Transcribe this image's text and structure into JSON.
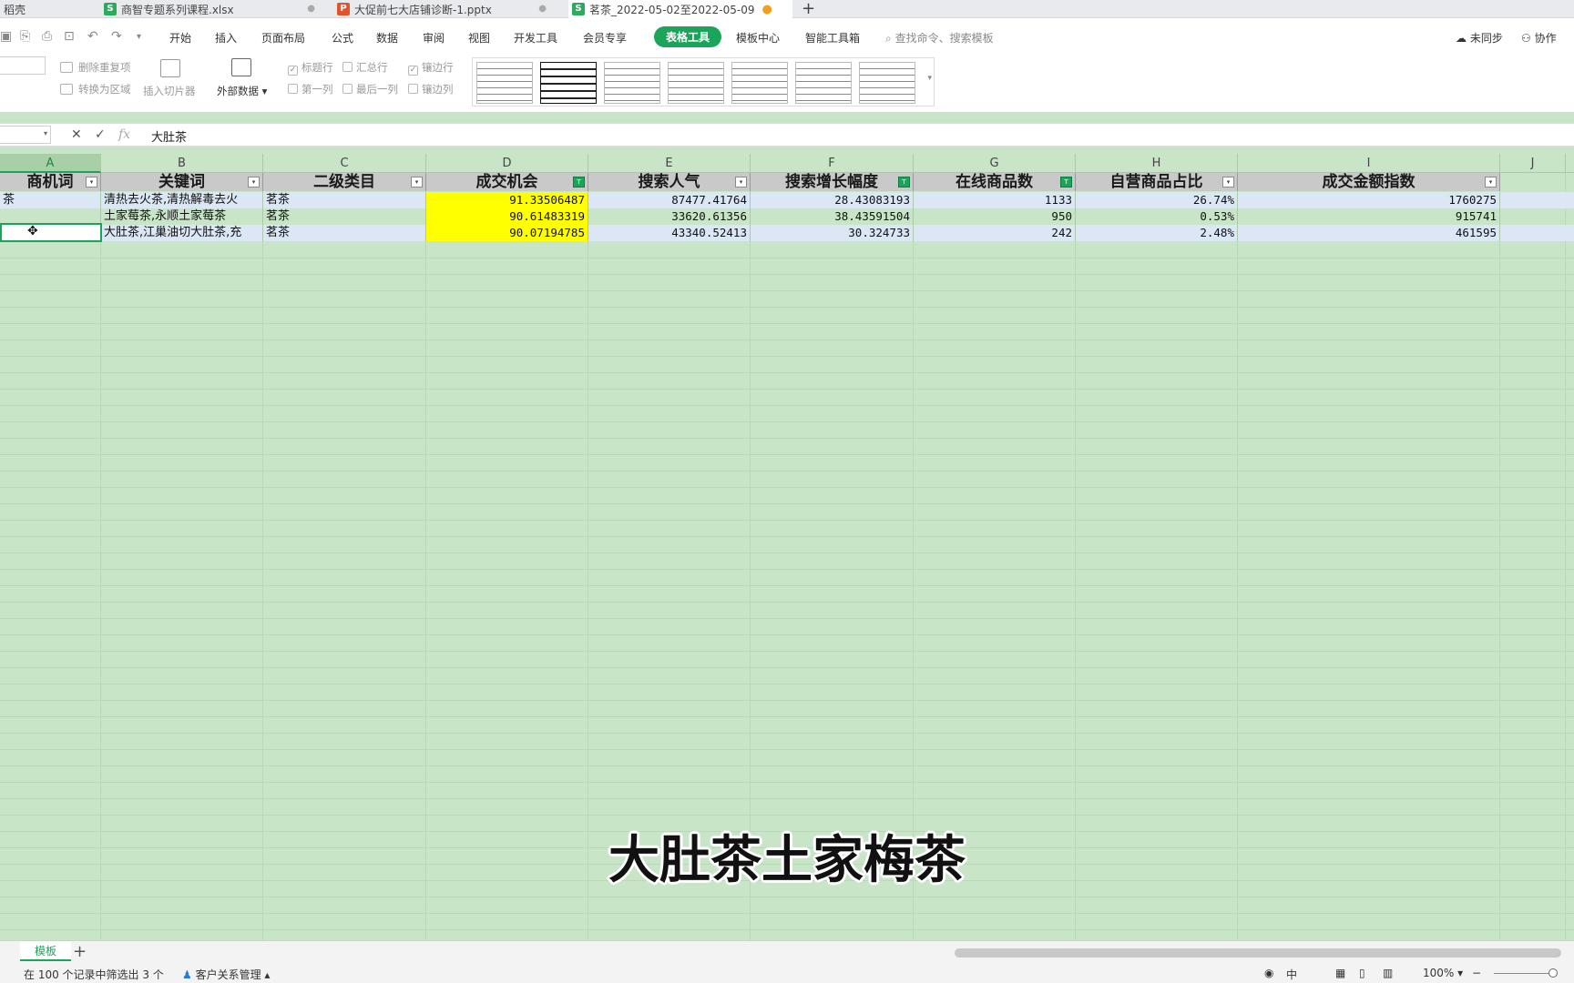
{
  "tabs": [
    {
      "label": "稻壳"
    },
    {
      "label": "商智专题系列课程.xlsx"
    },
    {
      "label": "大促前七大店铺诊断-1.pptx"
    },
    {
      "label": "茗茶_2022-05-02至2022-05-09"
    }
  ],
  "tab_plus": "+",
  "menu": {
    "items": [
      "开始",
      "插入",
      "页面布局",
      "公式",
      "数据",
      "审阅",
      "视图",
      "开发工具",
      "会员专享",
      "表格工具",
      "模板中心",
      "智能工具箱"
    ],
    "search_placeholder": "查找命令、搜索模板",
    "sync": "未同步",
    "collab": "协作"
  },
  "tools": {
    "remove_dup": "删除重复项",
    "to_range": "转换为区域",
    "insert_slicer": "插入切片器",
    "external_data": "外部数据",
    "header_row": "标题行",
    "total_row": "汇总行",
    "banded_rows": "镶边行",
    "first_col": "第一列",
    "last_col": "最后一列",
    "banded_cols": "镶边列"
  },
  "formula_bar": {
    "fx": "fx",
    "content": "大肚茶"
  },
  "columns": [
    "A",
    "B",
    "C",
    "D",
    "E",
    "F",
    "G",
    "H",
    "I",
    "J"
  ],
  "table": {
    "headers": [
      "商机词",
      "关键词",
      "二级类目",
      "成交机会",
      "搜索人气",
      "搜索增长幅度",
      "在线商品数",
      "自营商品占比",
      "成交金额指数"
    ],
    "rows": [
      [
        "茶",
        "清热去火茶,清热解毒去火",
        "茗茶",
        "91.33506487",
        "87477.41764",
        "28.43083193",
        "1133",
        "26.74%",
        "1760275"
      ],
      [
        "",
        "土家莓茶,永顺土家莓茶",
        "茗茶",
        "90.61483319",
        "33620.61356",
        "38.43591504",
        "950",
        "0.53%",
        "915741"
      ],
      [
        "",
        "大肚茶,江巢油切大肚茶,充",
        "茗茶",
        "90.07194785",
        "43340.52413",
        "30.324733",
        "242",
        "2.48%",
        "461595"
      ]
    ]
  },
  "subtitle": "大肚茶土家梅茶",
  "sheet": {
    "name": "模板",
    "add": "+"
  },
  "status": {
    "filter_info": "在 100 个记录中筛选出 3 个",
    "crm": "客户关系管理",
    "zoom": "100%"
  },
  "colors": {
    "accent": "#1aa55a",
    "highlight": "#ffff00",
    "sheet_bg": "#c9e5c8"
  }
}
